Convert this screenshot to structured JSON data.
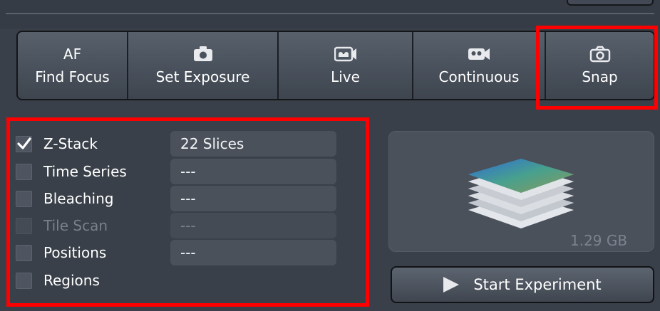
{
  "toolbar": {
    "buttons": [
      {
        "icon": "AF",
        "label": "Find Focus"
      },
      {
        "icon": "camera-icon",
        "label": "Set Exposure"
      },
      {
        "icon": "video-camera-icon",
        "label": "Live"
      },
      {
        "icon": "video-camera-icon",
        "label": "Continuous"
      },
      {
        "icon": "camera-outline-icon",
        "label": "Snap"
      }
    ]
  },
  "options": {
    "rows": [
      {
        "label": "Z-Stack",
        "checked": true,
        "enabled": true,
        "value": "22 Slices"
      },
      {
        "label": "Time Series",
        "checked": false,
        "enabled": true,
        "value": "---"
      },
      {
        "label": "Bleaching",
        "checked": false,
        "enabled": true,
        "value": "---"
      },
      {
        "label": "Tile Scan",
        "checked": false,
        "enabled": false,
        "value": "---"
      },
      {
        "label": "Positions",
        "checked": false,
        "enabled": true,
        "value": "---"
      },
      {
        "label": "Regions",
        "checked": false,
        "enabled": true
      }
    ]
  },
  "preview": {
    "size": "1.29 GB"
  },
  "start_button": {
    "label": "Start Experiment"
  },
  "colors": {
    "highlight": "#ff0000",
    "background": "#3a4049"
  }
}
